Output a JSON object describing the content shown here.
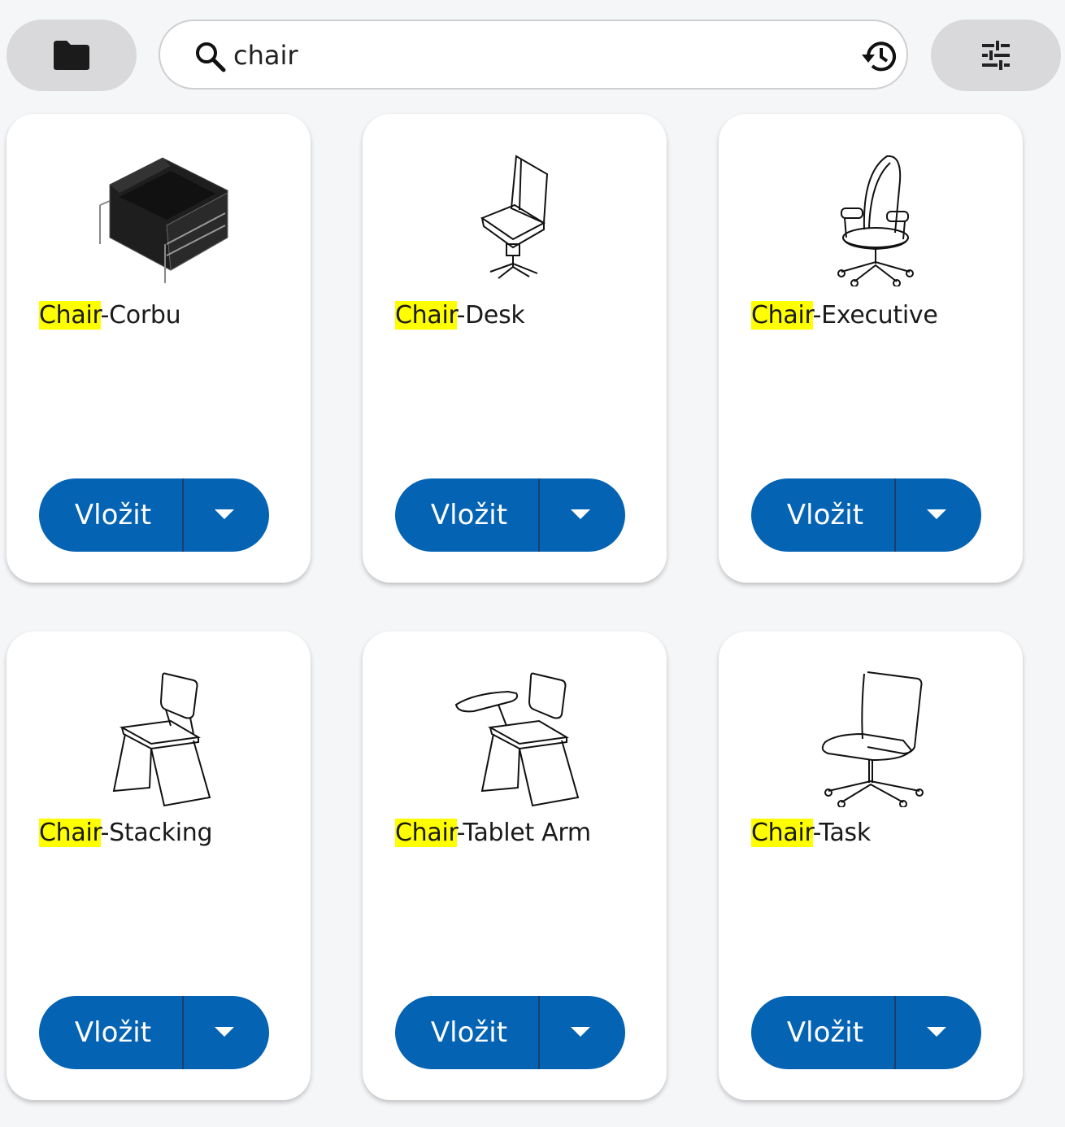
{
  "toolbar": {
    "folder_icon": "folder-icon",
    "filter_icon": "tune-icon"
  },
  "search": {
    "value": "chair",
    "search_icon": "search-icon",
    "history_icon": "history-icon"
  },
  "accent": "#0563b3",
  "highlight": "#ffff00",
  "cards": [
    {
      "highlight": "Chair",
      "rest": "-Corbu",
      "insert_label": "Vložit",
      "image": "chair-corbu-image"
    },
    {
      "highlight": "Chair",
      "rest": "-Desk",
      "insert_label": "Vložit",
      "image": "chair-desk-image"
    },
    {
      "highlight": "Chair",
      "rest": "-Executive",
      "insert_label": "Vložit",
      "image": "chair-executive-image"
    },
    {
      "highlight": "Chair",
      "rest": "-Stacking",
      "insert_label": "Vložit",
      "image": "chair-stacking-image"
    },
    {
      "highlight": "Chair",
      "rest": "-Tablet Arm",
      "insert_label": "Vložit",
      "image": "chair-tablet-arm-image"
    },
    {
      "highlight": "Chair",
      "rest": "-Task",
      "insert_label": "Vložit",
      "image": "chair-task-image"
    }
  ]
}
